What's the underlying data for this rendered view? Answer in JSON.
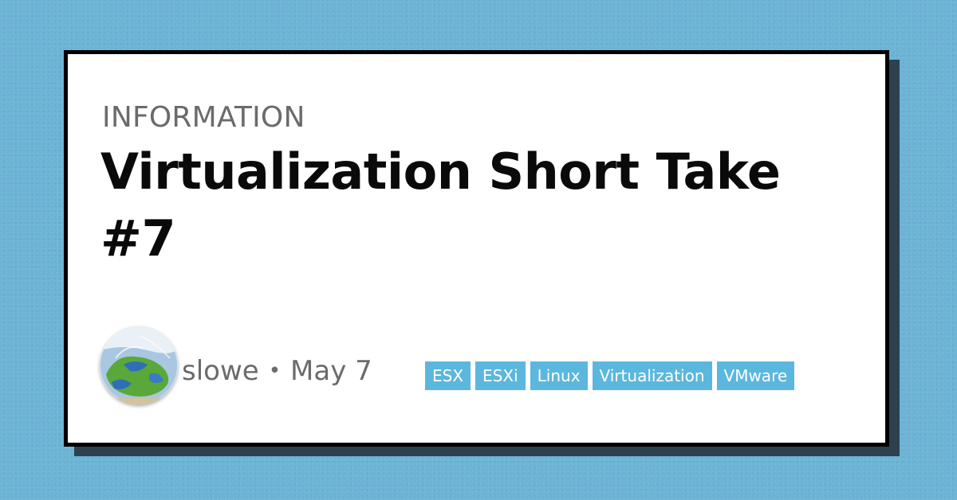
{
  "card": {
    "category": "INFORMATION",
    "title": "Virtualization Short Take #7"
  },
  "author": {
    "name": "slowe",
    "separator": "•",
    "date": "May 7",
    "avatar_icon": "globe-sketch-avatar"
  },
  "tags": [
    "ESX",
    "ESXi",
    "Linux",
    "Virtualization",
    "VMware"
  ],
  "colors": {
    "background": "#6cb3d5",
    "card": "#ffffff",
    "card_border": "#000000",
    "card_shadow": "#2d4150",
    "tag_background": "#5bb7dd",
    "tag_text": "#ffffff",
    "muted_text": "#6b6b6b",
    "title_text": "#0a0a0a"
  }
}
